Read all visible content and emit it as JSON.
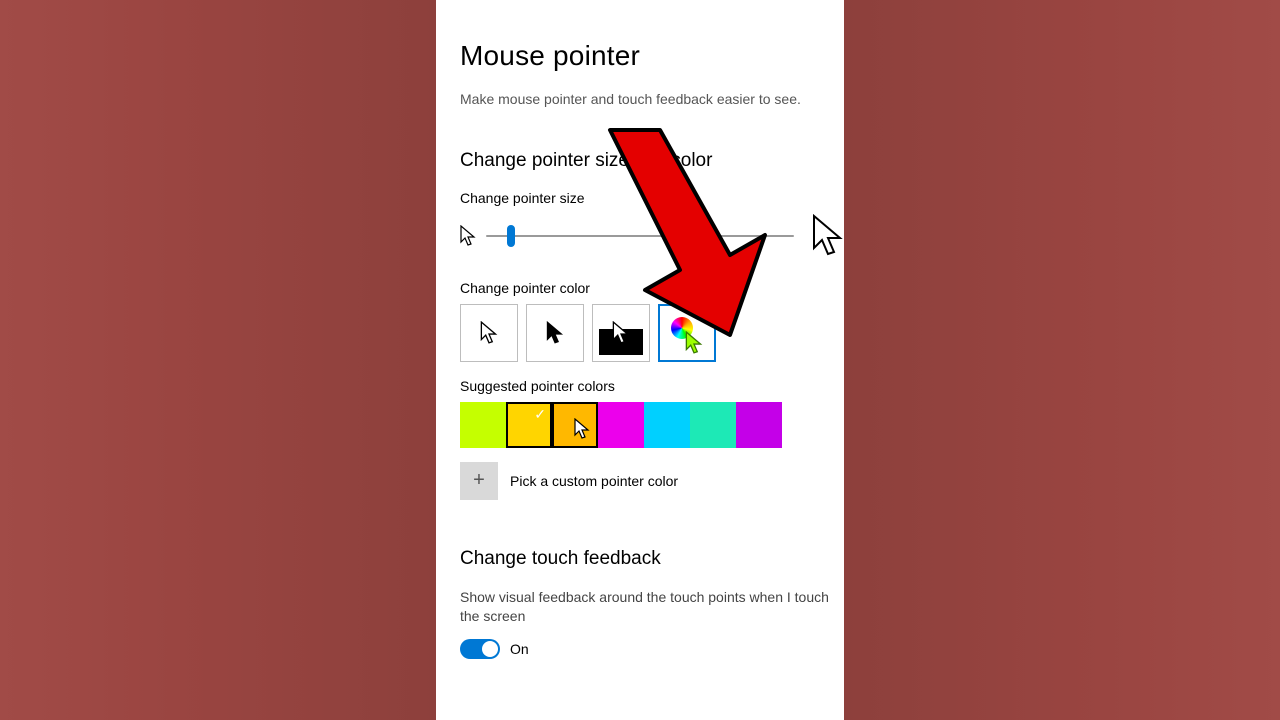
{
  "page": {
    "title": "Mouse pointer",
    "subtitle": "Make mouse pointer and touch feedback easier to see."
  },
  "section_pointer": {
    "heading": "Change pointer size and color",
    "size_label": "Change pointer size",
    "color_label": "Change pointer color",
    "suggested_label": "Suggested pointer colors",
    "pick_custom_label": "Pick a custom pointer color"
  },
  "pointer_style_options": [
    {
      "id": "white",
      "selected": false
    },
    {
      "id": "black",
      "selected": false
    },
    {
      "id": "inverted",
      "selected": false
    },
    {
      "id": "custom",
      "selected": true
    }
  ],
  "suggested_colors": [
    {
      "hex": "#c5ff00",
      "selected": false
    },
    {
      "hex": "#ffd500",
      "selected": true
    },
    {
      "hex": "#ffb800",
      "selected": false,
      "hover": true
    },
    {
      "hex": "#ec00ec",
      "selected": false
    },
    {
      "hex": "#00d0ff",
      "selected": false
    },
    {
      "hex": "#1de9b6",
      "selected": false
    },
    {
      "hex": "#c400e8",
      "selected": false
    }
  ],
  "section_touch": {
    "heading": "Change touch feedback",
    "description": "Show visual feedback around the touch points when I touch the screen",
    "toggle_state": "On"
  },
  "colors": {
    "accent": "#0078d4",
    "annotation_arrow": "#e40000"
  }
}
